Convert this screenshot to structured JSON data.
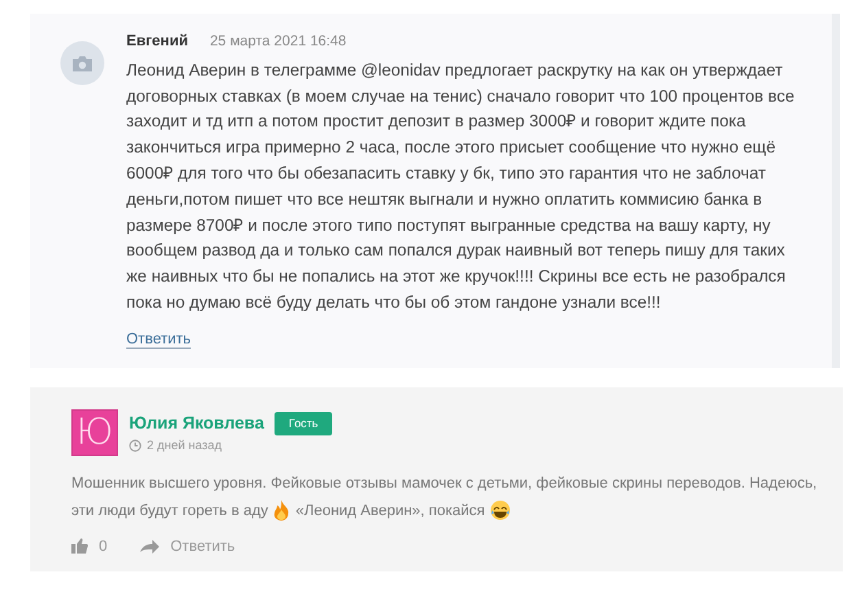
{
  "comments": [
    {
      "author": "Евгений",
      "date": "25 марта 2021 16:48",
      "text": "Леонид Аверин в телеграмме @leonidav предлогает раскрутку на как он утверждает договорных ставках (в моем случае на тенис) сначало говорит что 100 процентов все заходит и тд итп а потом простит депозит в размер 3000₽ и говорит ждите пока закончиться игра примерно 2 часа, после этого присыет сообщение что нужно ещё 6000₽ для того что бы обезапасить ставку у бк, типо это гарантия что не заблочат деньги,потом пишет что все нештяк выгнали и нужно оплатить коммисию банка в размере 8700₽ и после этого типо поступят выгранные средства на вашу карту, ну вообщем развод да и только сам попался дурак наивный вот теперь пишу для таких же наивных что бы не попались на этот же кручок!!!! Скрины все есть не разобрался пока но думаю всё буду делать что бы об этом гандоне узнали все!!!",
      "reply": "Ответить"
    },
    {
      "author": "Юлия Яковлева",
      "avatar_letter": "Ю",
      "badge": "Гость",
      "time": "2 дней назад",
      "segments": [
        {
          "kind": "line",
          "text": "Мошенник высшего уровня. Фейковые отзывы мамочек с детьми, фейковые скрины переводов. Надеюсь,"
        },
        {
          "kind": "text",
          "text": "эти люди будут гореть в аду"
        },
        {
          "kind": "fire"
        },
        {
          "kind": "text",
          "text": "«Леонид Аверин», покайся"
        },
        {
          "kind": "laugh"
        }
      ],
      "likes": "0",
      "reply": "Ответить"
    }
  ]
}
